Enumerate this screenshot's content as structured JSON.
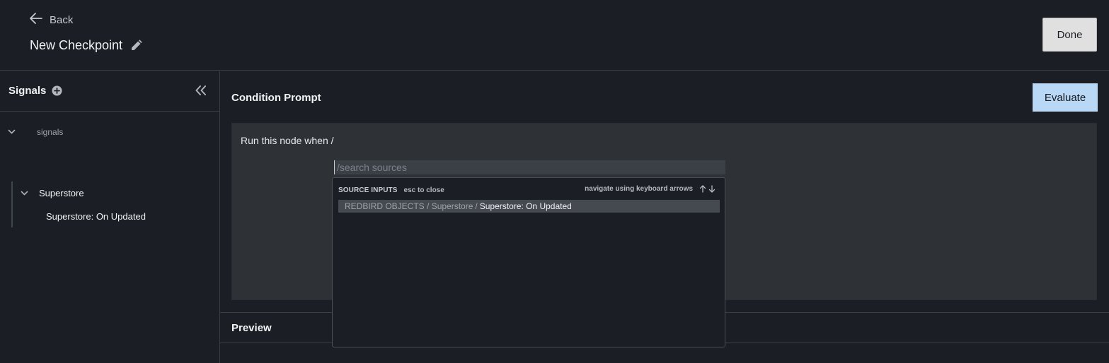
{
  "header": {
    "back_label": "Back",
    "title": "New Checkpoint",
    "done_label": "Done"
  },
  "sidebar": {
    "title": "Signals",
    "tree": {
      "root_label": "signals",
      "group_label": "Superstore",
      "item_label": "Superstore: On Updated"
    }
  },
  "main": {
    "condition_title": "Condition Prompt",
    "evaluate_label": "Evaluate",
    "prompt_text": "Run this node when /",
    "preview_title": "Preview"
  },
  "search": {
    "placeholder": "/search sources",
    "value": ""
  },
  "dropdown": {
    "section_label": "SOURCE INPUTS",
    "close_hint": "esc to close",
    "nav_hint": "navigate using keyboard arrows",
    "items": [
      {
        "path": "REDBIRD OBJECTS / Superstore",
        "separator": "/",
        "leaf": "Superstore: On Updated"
      }
    ]
  },
  "colors": {
    "background": "#1b1f25",
    "panel": "#2e3236",
    "accent_button": "#b9d8f6",
    "done_button": "#e0e0e0",
    "highlight_row": "#454a51"
  }
}
